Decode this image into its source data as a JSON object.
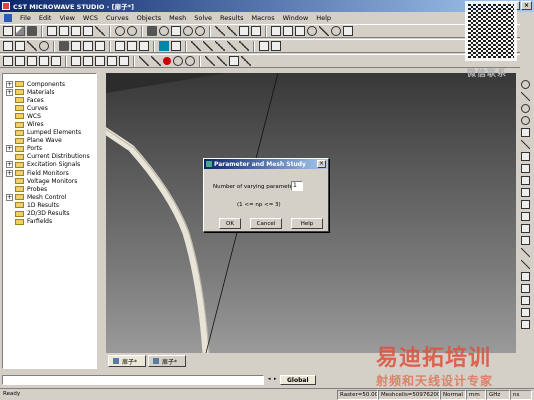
{
  "window": {
    "title": "CST MICROWAVE STUDIO - [扉子*]",
    "buttons": [
      "_",
      "□",
      "×"
    ]
  },
  "menu": [
    "File",
    "Edit",
    "View",
    "WCS",
    "Curves",
    "Objects",
    "Mesh",
    "Solve",
    "Results",
    "Macros",
    "Window",
    "Help"
  ],
  "tree": [
    {
      "label": "Components",
      "expand": "+"
    },
    {
      "label": "Materials",
      "expand": "+"
    },
    {
      "label": "Faces",
      "expand": ""
    },
    {
      "label": "Curves",
      "expand": ""
    },
    {
      "label": "WCS",
      "expand": ""
    },
    {
      "label": "Wires",
      "expand": ""
    },
    {
      "label": "Lumped Elements",
      "expand": ""
    },
    {
      "label": "Plane Wave",
      "expand": ""
    },
    {
      "label": "Ports",
      "expand": "+"
    },
    {
      "label": "Current Distributions",
      "expand": ""
    },
    {
      "label": "Excitation Signals",
      "expand": "+"
    },
    {
      "label": "Field Monitors",
      "expand": "+"
    },
    {
      "label": "Voltage Monitors",
      "expand": ""
    },
    {
      "label": "Probes",
      "expand": ""
    },
    {
      "label": "Mesh Control",
      "expand": "+"
    },
    {
      "label": "1D Results",
      "expand": ""
    },
    {
      "label": "2D/3D Results",
      "expand": ""
    },
    {
      "label": "Farfields",
      "expand": ""
    }
  ],
  "view_tabs": [
    "扉子*",
    "扉子*"
  ],
  "dialog": {
    "title": "Parameter and Mesh Study",
    "label": "Number of varying parameters:",
    "value": "1",
    "hint": "(1 <= np <= 3)",
    "ok": "OK",
    "cancel": "Cancel",
    "help": "Help"
  },
  "bottom": {
    "global_tab": "Global"
  },
  "status": {
    "ready": "Ready",
    "raster": "Raster=50.000",
    "meshcells": "Meshcells=50976200",
    "mode": "Normal",
    "unit": "mm",
    "freq": "GHz",
    "time": "ns"
  },
  "watermark": {
    "caption": "微信联系",
    "brand": "易迪拓培训",
    "slogan": "射频和天线设计专家"
  }
}
